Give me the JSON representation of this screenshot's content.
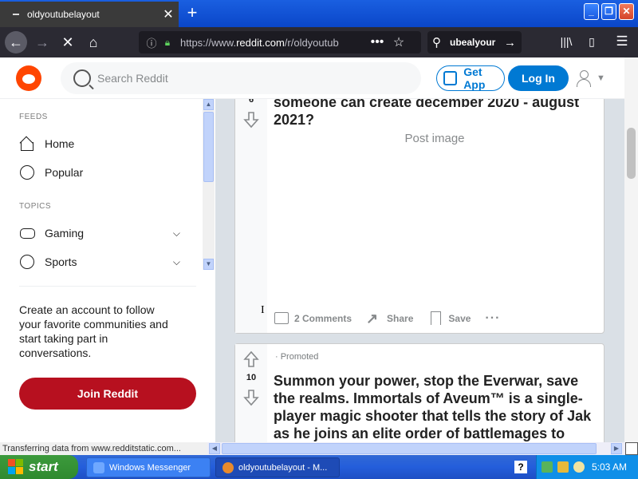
{
  "browser": {
    "tab_title": "oldyoutubelayout",
    "tab_close": "✕",
    "new_tab": "+",
    "url_domain": "https://www.",
    "url_host": "reddit.com",
    "url_path": "/r/oldyoutub",
    "search_text": "ubealyour",
    "window_buttons": {
      "minimize": "_",
      "maximize": "❐",
      "close": "✕"
    }
  },
  "reddit_header": {
    "search_placeholder": "Search Reddit",
    "get_app_label": "Get App",
    "login_label": "Log In"
  },
  "sidebar": {
    "feeds_label": "FEEDS",
    "feeds": [
      {
        "label": "Home"
      },
      {
        "label": "Popular"
      }
    ],
    "topics_label": "TOPICS",
    "topics": [
      {
        "label": "Gaming"
      },
      {
        "label": "Sports"
      }
    ],
    "promo_text": "Create an account to follow your favorite communities and start taking part in conversations.",
    "join_label": "Join Reddit"
  },
  "posts": [
    {
      "score": "6",
      "title": "someone can create december 2020 - august 2021?",
      "image_label": "Post image",
      "comments_label": "2 Comments",
      "share_label": "Share",
      "save_label": "Save",
      "more_label": "···"
    },
    {
      "promoted_label": "· Promoted",
      "score": "10",
      "title": "Summon your power, stop the Everwar, save the realms. Immortals of Aveum™ is a single-player magic shooter that tells the story of Jak as he joins an elite order of battlemages to save a"
    }
  ],
  "status_text": "Transferring data from www.redditstatic.com...",
  "taskbar": {
    "start_label": "start",
    "tasks": [
      {
        "label": "Windows Messenger"
      },
      {
        "label": "oldyoutubelayout - M..."
      }
    ],
    "help_label": "?",
    "clock": "5:03 AM"
  },
  "colors": {
    "reddit_orange": "#ff4500",
    "reddit_blue": "#0079d3",
    "join_red": "#b7101f",
    "xp_blue": "#245edb"
  }
}
